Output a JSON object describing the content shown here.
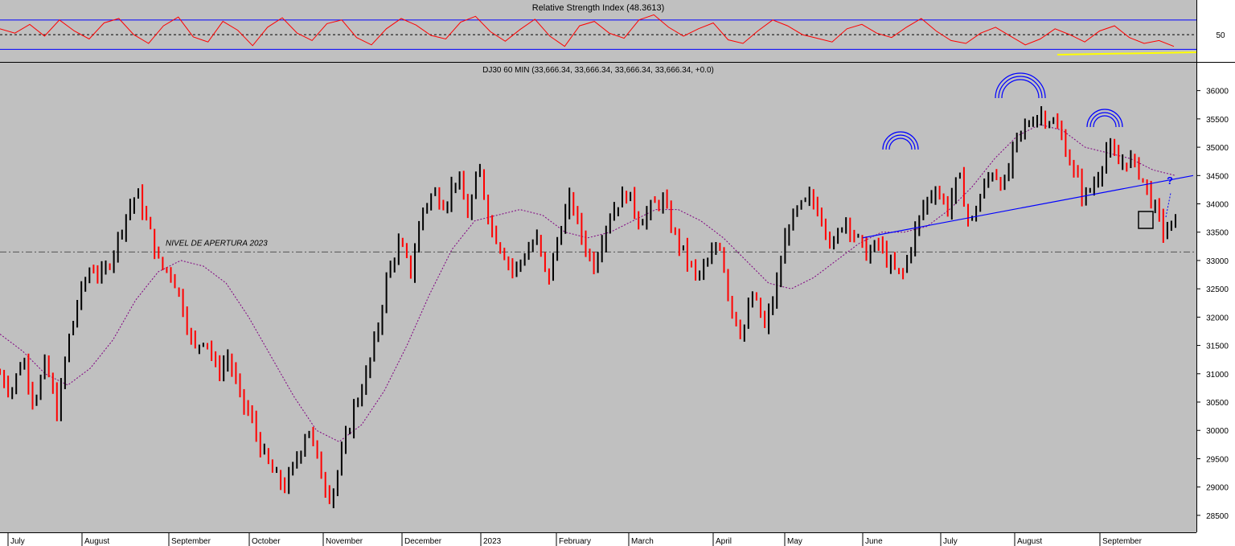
{
  "chart_data": [
    {
      "panel": "rsi",
      "type": "line",
      "title": "Relative Strength Index (48.3613)",
      "value": 48.3613,
      "reference_levels": [
        30,
        50,
        70
      ],
      "y_tick_labels": [
        "50"
      ],
      "ylim": [
        15,
        95
      ],
      "grid": false,
      "colors": {
        "rsi": "#ff0000",
        "bands": "#0000ff",
        "midline": "#000000",
        "support": "#ffff00"
      },
      "series": [
        {
          "values": [
            58,
            52,
            64,
            48,
            70,
            55,
            44,
            66,
            72,
            50,
            38,
            62,
            74,
            47,
            40,
            68,
            56,
            35,
            60,
            73,
            52,
            42,
            65,
            70,
            46,
            36,
            58,
            72,
            63,
            49,
            44,
            67,
            75,
            54,
            41,
            57,
            71,
            48,
            34,
            62,
            68,
            52,
            45,
            70,
            77,
            60,
            48,
            58,
            66,
            43,
            38,
            55,
            70,
            62,
            50,
            45,
            40,
            58,
            64,
            52,
            46,
            60,
            72,
            55,
            42,
            38,
            52,
            60,
            48,
            36,
            44,
            58,
            50,
            40,
            55,
            62,
            46,
            38,
            42,
            34
          ]
        }
      ]
    },
    {
      "panel": "price",
      "type": "line",
      "title": "DJ30 60 MIN (33,666.34, 33,666.34, 33,666.34, 33,666.34, +0.0)",
      "ylim": [
        28200,
        36350
      ],
      "y_ticks": [
        28500,
        29000,
        29500,
        30000,
        30500,
        31000,
        31500,
        32000,
        32500,
        33000,
        33500,
        34000,
        34500,
        35000,
        35500,
        36000
      ],
      "x_tick_labels": [
        "July",
        "August",
        "September",
        "October",
        "November",
        "December",
        "2023",
        "February",
        "March",
        "April",
        "May",
        "June",
        "July",
        "August",
        "September"
      ],
      "grid": false,
      "colors": {
        "up": "#000000",
        "down": "#ff0000",
        "moving_average": "#800080",
        "trendline": "#0000ff",
        "opening_level": "#444444"
      },
      "series": [
        {
          "values": [
            31000,
            30700,
            31300,
            30500,
            31200,
            30300,
            31600,
            32400,
            32900,
            32700,
            33200,
            33800,
            34200,
            33600,
            32900,
            32800,
            32200,
            31400,
            31700,
            31000,
            31300,
            30600,
            30200,
            29600,
            29200,
            29000,
            29500,
            30100,
            29300,
            28800,
            29600,
            30400,
            30900,
            31700,
            32800,
            33300,
            32800,
            33900,
            34200,
            34000,
            34500,
            33800,
            34600,
            33600,
            33200,
            32800,
            33100,
            33400,
            32600,
            33500,
            34100,
            33400,
            32900,
            33600,
            34000,
            34200,
            33700,
            33900,
            34100,
            33500,
            33100,
            32700,
            32900,
            33400,
            32200,
            31700,
            32400,
            31800,
            32500,
            33600,
            33900,
            34100,
            33800,
            33200,
            33800,
            33400,
            33100,
            33300,
            32900,
            32700,
            33400,
            34000,
            34300,
            33900,
            34500,
            33600,
            34200,
            34600,
            34300,
            35100,
            35400,
            35600,
            35500,
            35200,
            34600,
            34100,
            34400,
            35000,
            34700,
            34800,
            34500,
            34000,
            33500,
            33666
          ]
        },
        {
          "name": "",
          "values": [
            31700,
            31400,
            31000,
            30800,
            31100,
            31600,
            32300,
            32800,
            33000,
            32900,
            32600,
            32000,
            31300,
            30600,
            30000,
            29800,
            30100,
            30700,
            31500,
            32400,
            33200,
            33700,
            33800,
            33900,
            33800,
            33500,
            33400,
            33500,
            33700,
            33900,
            33900,
            33700,
            33400,
            33000,
            32600,
            32500,
            32700,
            33000,
            33300,
            33500,
            33500,
            33600,
            33900,
            34300,
            34800,
            35200,
            35400,
            35300,
            35000,
            34900,
            34800,
            34600,
            34500
          ]
        }
      ],
      "trendline": {
        "from": [
          "June",
          33400
        ],
        "to": [
          "September",
          34500
        ]
      },
      "annotations": [
        {
          "text": "NIVEL DE APERTURA 2023",
          "value": 33150
        },
        {
          "text": "?"
        }
      ]
    }
  ]
}
